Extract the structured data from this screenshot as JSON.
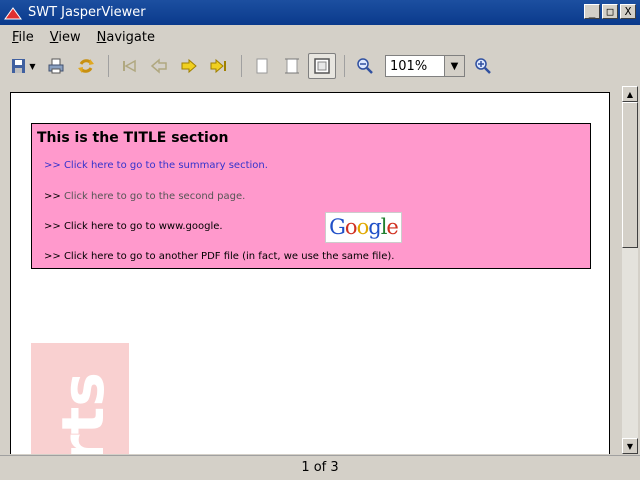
{
  "window": {
    "title": "SWT JasperViewer",
    "buttons": [
      "_",
      "□",
      "X"
    ]
  },
  "menu": [
    {
      "underline": "F",
      "rest": "ile"
    },
    {
      "underline": "V",
      "rest": "iew"
    },
    {
      "underline": "N",
      "rest": "avigate"
    }
  ],
  "toolbar": {
    "zoom_value": "101%"
  },
  "report": {
    "title": "This is the TITLE section",
    "arrow": ">>",
    "links": [
      "Click here to go to the summary section.",
      "Click here to go to the second page.",
      "Click here to go to www.google.",
      "Click here to go to another PDF file (in fact, we use the same file)."
    ],
    "google_logo": "Google",
    "watermark": "rts"
  },
  "colors": {
    "title_bar": "#0a3a8c",
    "section_bg": "#ff99cc",
    "link_blue": "#3333cc"
  },
  "status": {
    "page": "1 of 3"
  }
}
